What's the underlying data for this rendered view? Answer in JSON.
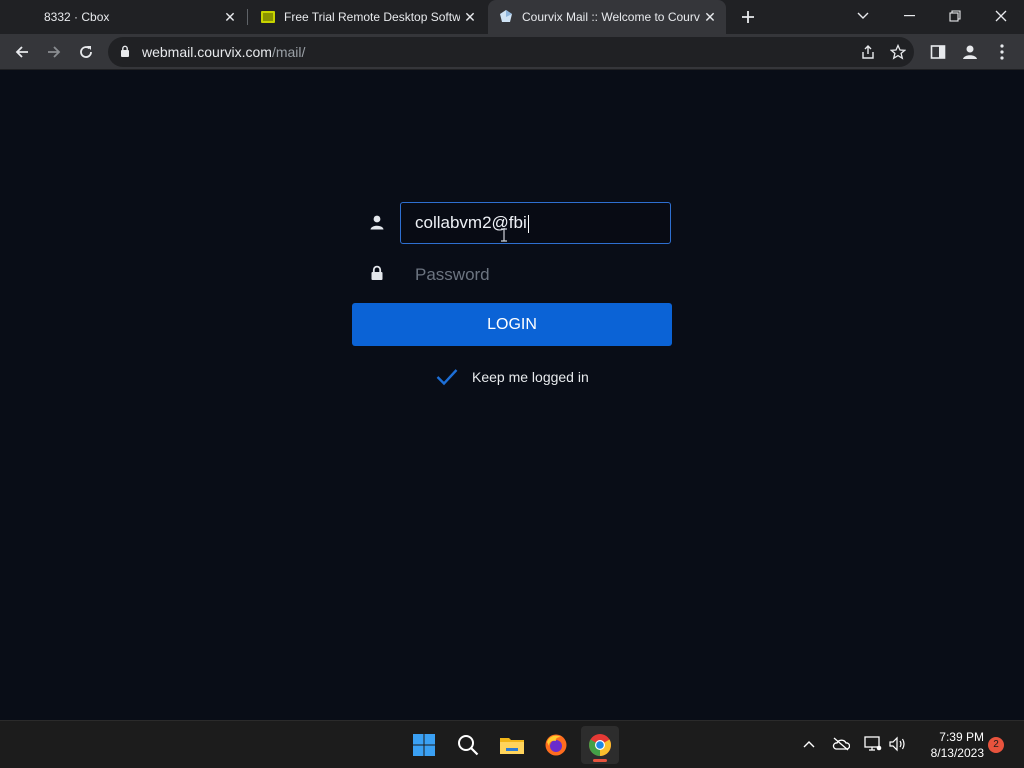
{
  "browser": {
    "tabs": [
      {
        "title": "8332 · Cbox",
        "active": false
      },
      {
        "title": "Free Trial Remote Desktop Software",
        "active": false
      },
      {
        "title": "Courvix Mail :: Welcome to Courvix Mail",
        "active": true
      }
    ],
    "url": {
      "host": "webmail.courvix.com",
      "path": "/mail/"
    }
  },
  "login": {
    "username_value": "collabvm2@fbi",
    "password_placeholder": "Password",
    "login_label": "LOGIN",
    "keep_logged_in_label": "Keep me logged in",
    "keep_logged_in_checked": true
  },
  "taskbar": {
    "apps": [
      "start-icon",
      "search-icon",
      "file-explorer-icon",
      "firefox-icon",
      "chrome-icon"
    ],
    "time": "7:39 PM",
    "date": "8/13/2023",
    "notification_count": "2"
  },
  "colors": {
    "page_bg": "#090d17",
    "accent": "#0b63d6",
    "field_border": "#2e6fd0",
    "notification": "#e8533d"
  }
}
